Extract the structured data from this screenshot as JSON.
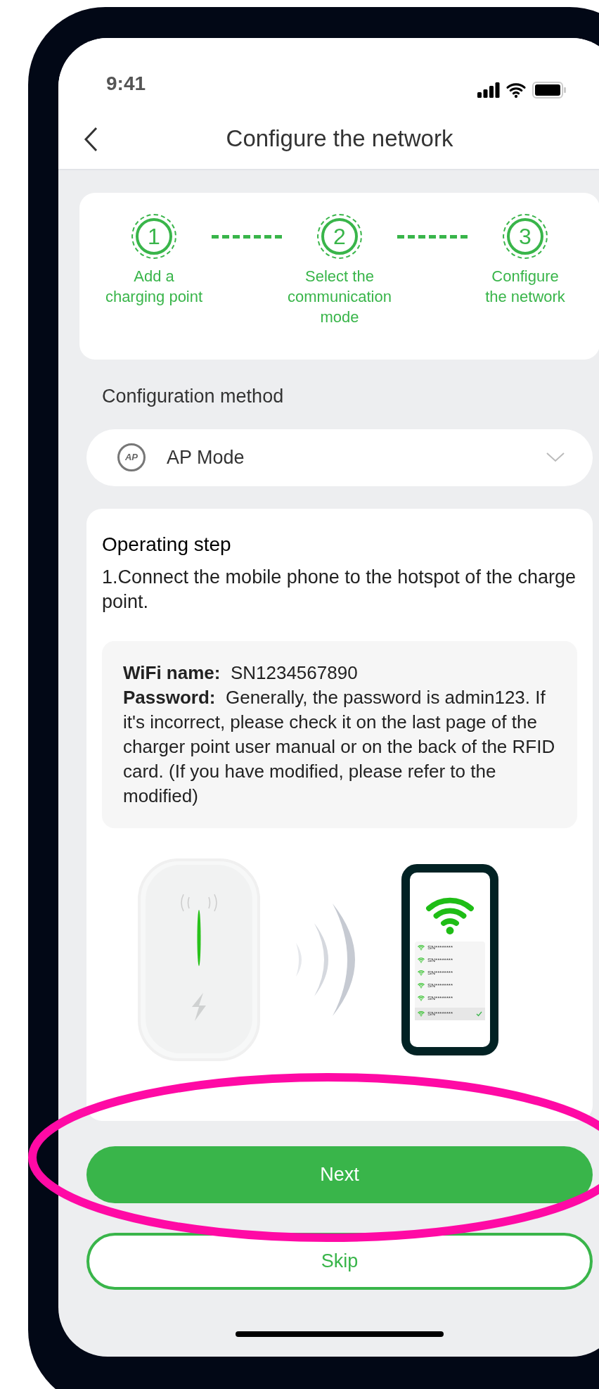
{
  "status_bar": {
    "time": "9:41"
  },
  "header": {
    "title": "Configure the network"
  },
  "steps": [
    {
      "number": "1",
      "label": "Add a\ncharging point"
    },
    {
      "number": "2",
      "label": "Select the\ncommunication\nmode"
    },
    {
      "number": "3",
      "label": "Configure\nthe network"
    }
  ],
  "configuration": {
    "label": "Configuration method",
    "badge": "AP",
    "mode": "AP Mode"
  },
  "operating": {
    "title": "Operating step",
    "instruction": "1.Connect the mobile phone to the hotspot of the charge point.",
    "info": [
      "**WiFi name:**  SN1234567890",
      "**Password:**  Generally, the password is admin123. If it's incorrect, please check it on the last page of the charger point user manual or on the back of the RFID card. (If you have modified, please refer to the modified)"
    ],
    "networks": [
      {
        "ssid": "SN********",
        "selected": false
      },
      {
        "ssid": "SN********",
        "selected": false
      },
      {
        "ssid": "SN********",
        "selected": false
      },
      {
        "ssid": "SN********",
        "selected": false
      },
      {
        "ssid": "SN********",
        "selected": false
      },
      {
        "ssid": "SN********",
        "selected": true
      }
    ]
  },
  "buttons": {
    "next": "Next",
    "skip": "Skip"
  }
}
